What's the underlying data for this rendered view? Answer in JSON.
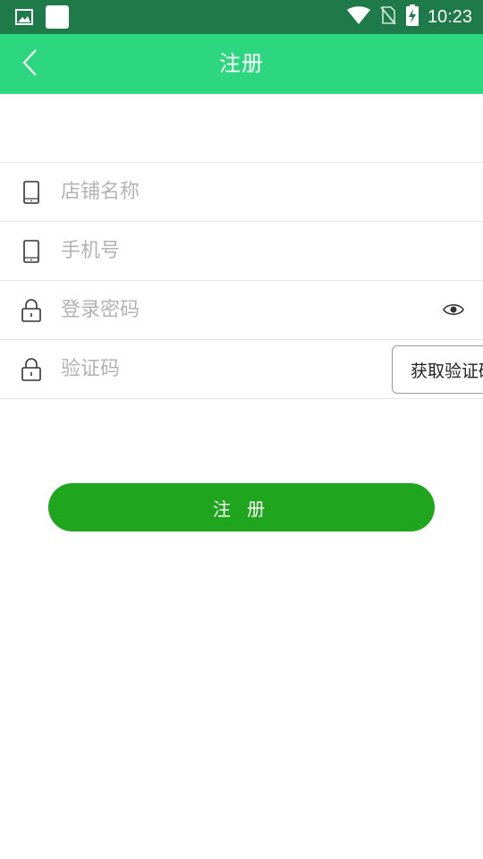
{
  "status_bar": {
    "time": "10:23",
    "icons": [
      "image-icon",
      "app-square-icon",
      "wifi-icon",
      "no-sim-icon",
      "battery-charging-icon"
    ]
  },
  "app_bar": {
    "title": "注册",
    "back_icon": "chevron-left-icon",
    "background_color": "#2dd780"
  },
  "form": {
    "fields": [
      {
        "name": "store-name",
        "icon": "phone-icon",
        "placeholder": "店铺名称",
        "value": ""
      },
      {
        "name": "phone-number",
        "icon": "phone-icon",
        "placeholder": "手机号",
        "value": ""
      },
      {
        "name": "login-password",
        "icon": "lock-icon",
        "placeholder": "登录密码",
        "value": "",
        "trailing_icon": "eye-icon"
      },
      {
        "name": "verification-code",
        "icon": "lock-icon",
        "placeholder": "验证码",
        "value": "",
        "action_label": "获取验证码"
      }
    ]
  },
  "submit": {
    "label": "注 册",
    "color": "#20a61e"
  }
}
